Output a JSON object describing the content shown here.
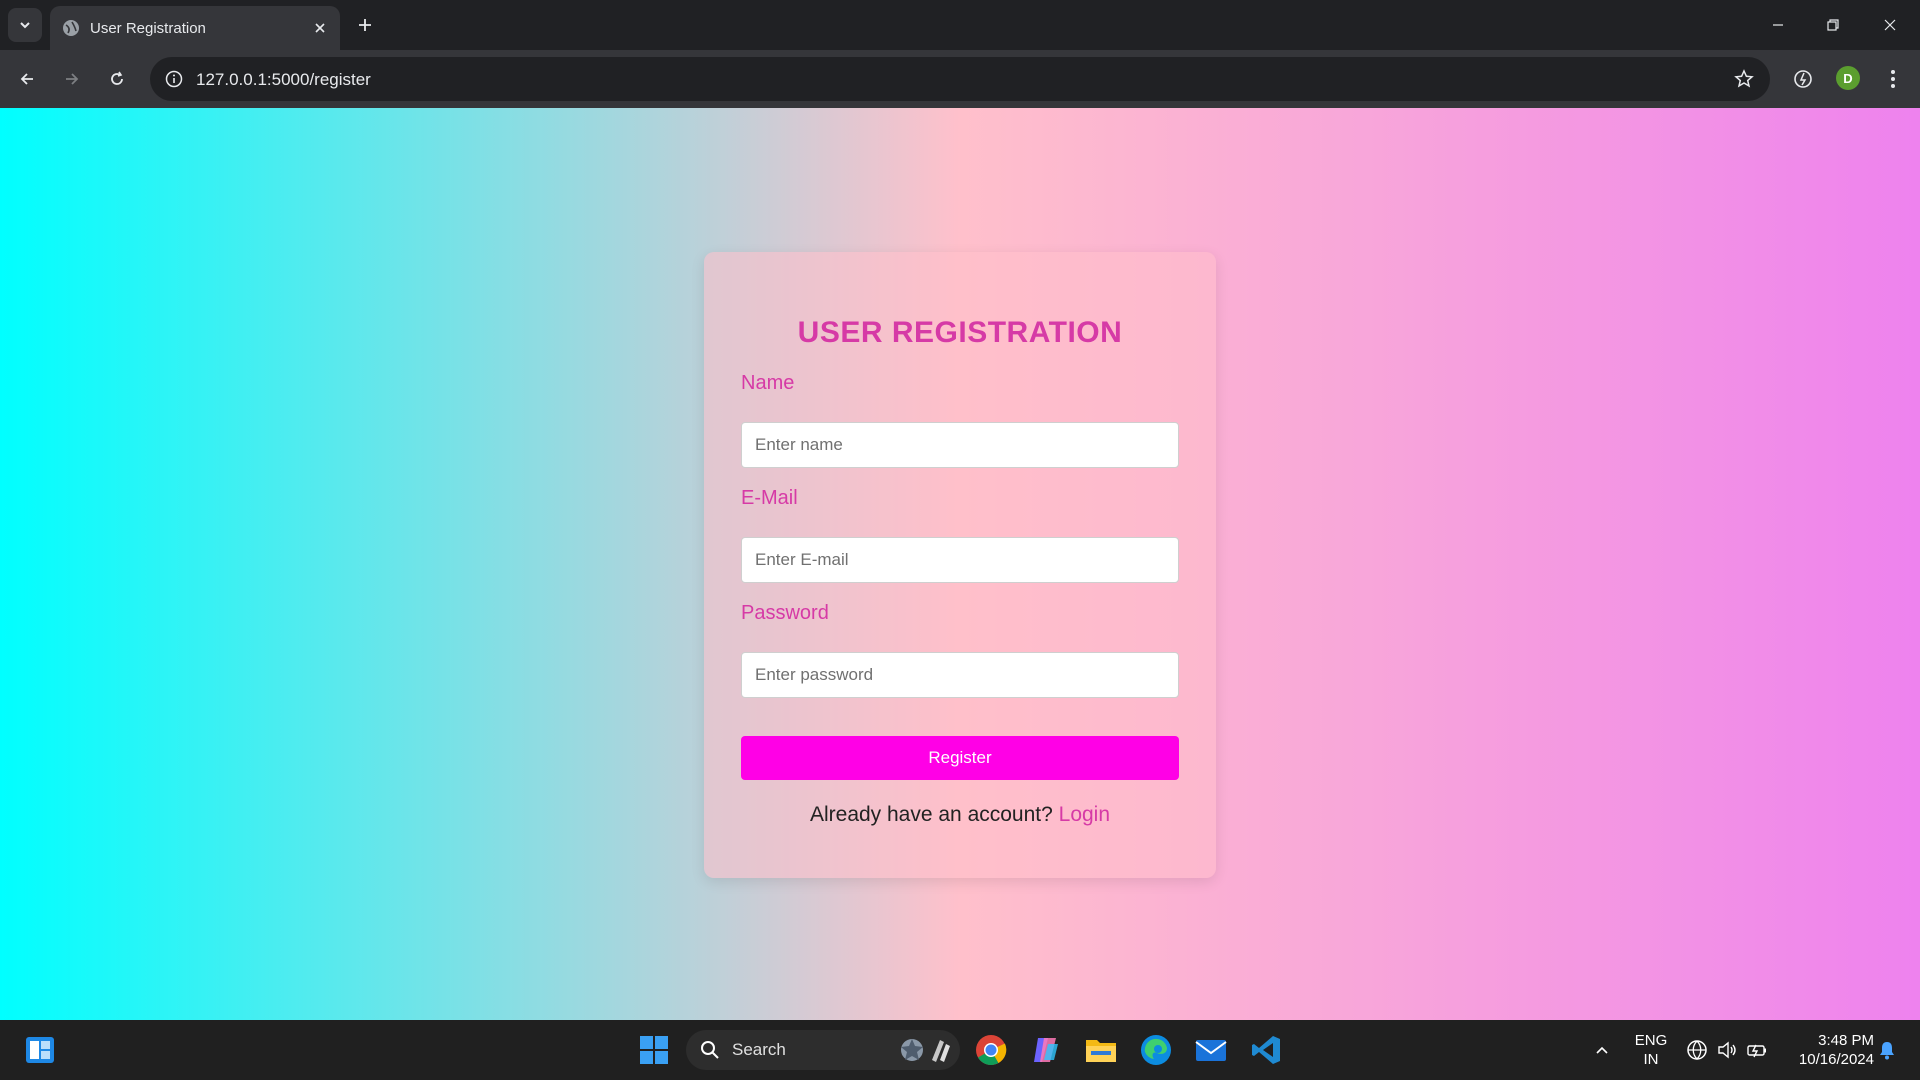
{
  "browser": {
    "tab_title": "User Registration",
    "url": "127.0.0.1:5000/register",
    "profile_initial": "D"
  },
  "form": {
    "title": "USER REGISTRATION",
    "name_label": "Name",
    "name_placeholder": "Enter name",
    "email_label": "E-Mail",
    "email_placeholder": "Enter E-mail",
    "password_label": "Password",
    "password_placeholder": "Enter password",
    "submit_label": "Register",
    "account_prompt": "Already have an account? ",
    "login_link": "Login"
  },
  "taskbar": {
    "search_label": "Search",
    "lang_line1": "ENG",
    "lang_line2": "IN",
    "time": "3:48 PM",
    "date": "10/16/2024"
  },
  "colors": {
    "gradient_start": "#00ffff",
    "gradient_mid": "#ffc0cb",
    "gradient_end": "#ee82ee",
    "accent": "#d63aa6",
    "button": "#ff00e6"
  }
}
